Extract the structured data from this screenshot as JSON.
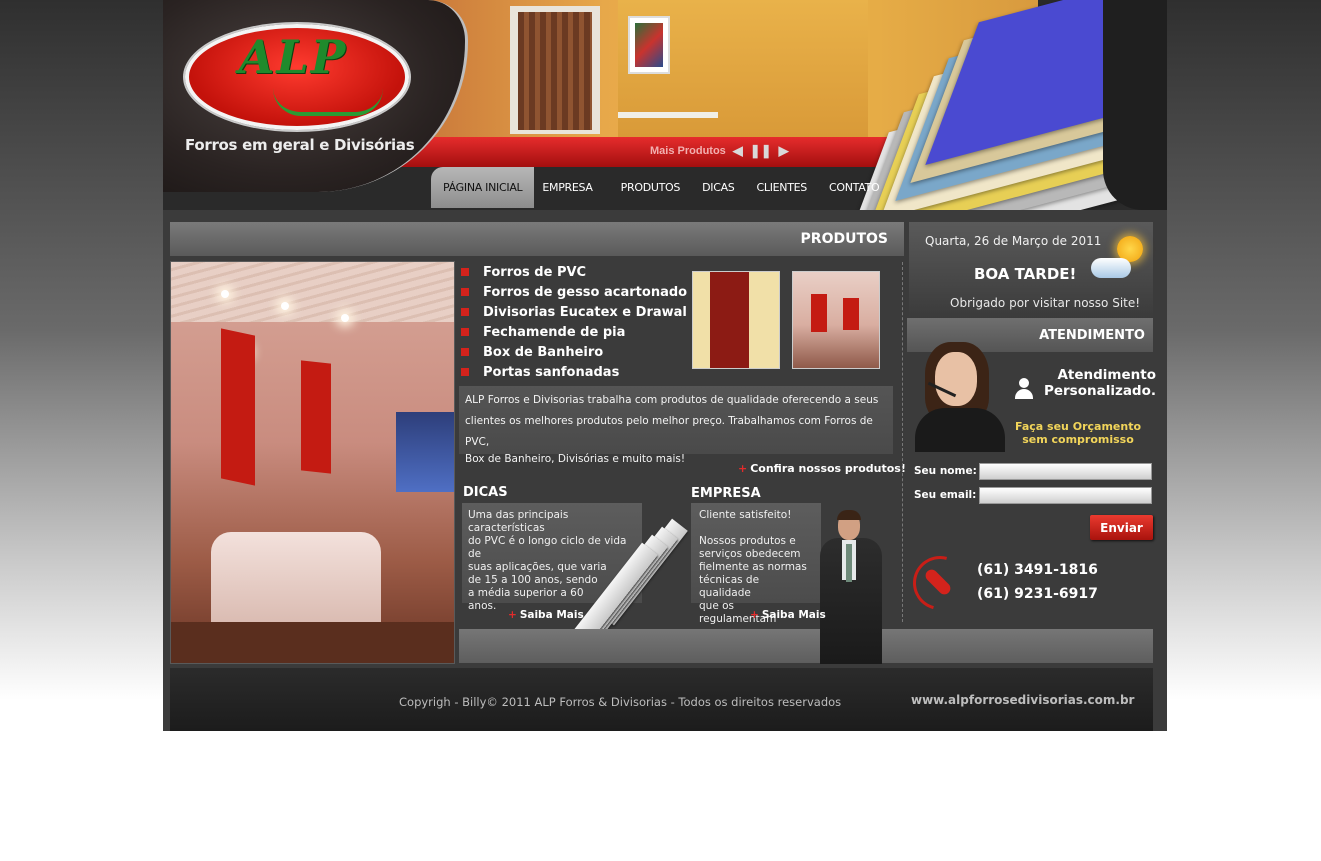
{
  "header": {
    "logo_text": "ALP",
    "tagline": "Forros em geral  e  Divisórias",
    "more_products": "Mais Produtos",
    "nav": [
      {
        "label": "PÁGINA INICIAL"
      },
      {
        "label": "EMPRESA"
      },
      {
        "label": "PRODUTOS"
      },
      {
        "label": "DICAS"
      },
      {
        "label": "CLIENTES"
      },
      {
        "label": "CONTATO"
      }
    ],
    "active_nav": "PÁGINA INICIAL"
  },
  "products": {
    "title": "PRODUTOS",
    "items": [
      {
        "label": "Forros de PVC"
      },
      {
        "label": "Forros de gesso acartonado"
      },
      {
        "label": "Divisorias Eucatex e Drawal"
      },
      {
        "label": "Fechamende de pia"
      },
      {
        "label": "Box de Banheiro"
      },
      {
        "label": "Portas sanfonadas"
      }
    ],
    "intro_lines": [
      "ALP Forros e Divisorias trabalha com produtos de qualidade oferecendo a seus",
      "clientes os melhores produtos pelo melhor preço. Trabalhamos com Forros de PVC,",
      "Box de Banheiro, Divisórias e muito mais!"
    ],
    "cta": "Confira nossos produtos!"
  },
  "dicas": {
    "title": "DICAS",
    "lines": [
      "Uma das principais características",
      "do PVC é o longo ciclo de vida de",
      "suas aplicações, que varia",
      "de 15 a 100 anos, sendo",
      "a média superior a 60",
      "anos."
    ],
    "more": "Saiba Mais"
  },
  "empresa": {
    "title": "EMPRESA",
    "lines": [
      "Cliente satisfeito!",
      "",
      "Nossos produtos e",
      "serviços obedecem",
      "fielmente as normas",
      "técnicas de qualidade",
      "que os regulamentam"
    ],
    "more": "Saiba Mais"
  },
  "sidebar": {
    "date": "Quarta, 26 de Março de 2011",
    "greeting": "BOA TARDE!",
    "thanks": "Obrigado por visitar nosso Site!",
    "atendimento_title": "ATENDIMENTO",
    "atendimento_line1": "Atendimento",
    "atendimento_line2": "Personalizado.",
    "orcamento_line1": "Faça seu Orçamento",
    "orcamento_line2": "sem compromisso",
    "name_label": "Seu nome:",
    "name_value": "",
    "email_label": "Seu email:",
    "email_value": "",
    "submit_label": "Enviar",
    "phone1": "(61) 3491-1816",
    "phone2": "(61) 9231-6917"
  },
  "footer": {
    "copyright": "Copyrigh - Billy© 2011 ALP Forros & Divisorias - Todos os direitos reservados",
    "site_url": "www.alpforrosedivisorias.com.br"
  },
  "colors": {
    "accent_red": "#d4231c",
    "logo_green": "#1f8a2c",
    "panel_gray": "#3b3b3b",
    "highlight_yellow": "#f2d55a"
  }
}
